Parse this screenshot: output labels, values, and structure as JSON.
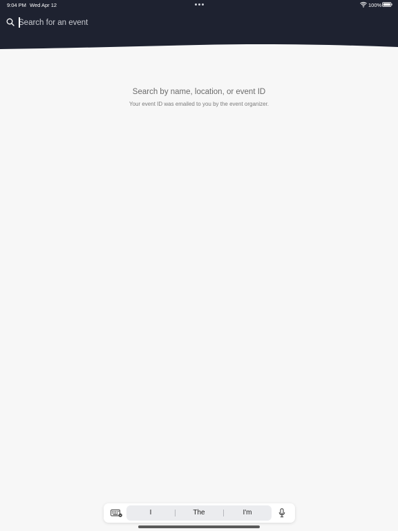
{
  "status_bar": {
    "time": "9:04 PM",
    "date": "Wed Apr 12",
    "battery": "100%",
    "wifi_icon": "wifi-icon",
    "battery_icon": "battery-icon"
  },
  "search": {
    "placeholder": "Search for an event",
    "value": "",
    "icon": "search-icon"
  },
  "empty_state": {
    "title": "Search by name, location, or event ID",
    "subtitle": "Your event ID was emailed to you by the event organizer."
  },
  "keyboard_bar": {
    "suggestions": [
      "I",
      "The",
      "I'm"
    ],
    "keyboard_icon": "keyboard-icon",
    "mic_icon": "microphone-icon"
  },
  "colors": {
    "header_bg": "#1e2230",
    "page_bg": "#f7f7f7",
    "text_muted": "#6b6b6b"
  }
}
